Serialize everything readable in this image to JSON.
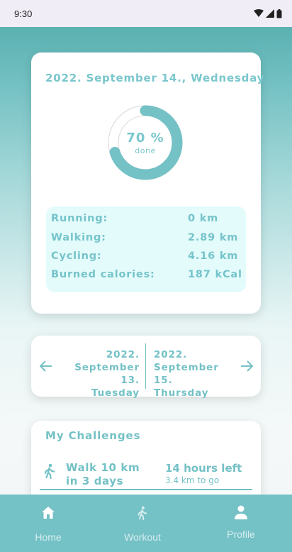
{
  "status_bar": {
    "time": "9:30"
  },
  "summary": {
    "date": "2022. September 14., Wednesday",
    "progress_percent": 70,
    "progress_label": "70 %",
    "progress_caption": "done",
    "stats": [
      {
        "label": "Running:",
        "value": "0 km"
      },
      {
        "label": "Walking:",
        "value": "2.89 km"
      },
      {
        "label": "Cycling:",
        "value": "4.16 km"
      },
      {
        "label": "Burned calories:",
        "value": "187 kCal"
      }
    ]
  },
  "day_nav": {
    "prev_year": "2022.",
    "prev_date": "September 13.",
    "prev_weekday": "Tuesday",
    "next_year": "2022.",
    "next_date": "September 15.",
    "next_weekday": "Thursday"
  },
  "challenges": {
    "title": "My Challenges",
    "items": [
      {
        "name_line1": "Walk 10 km",
        "name_line2": "in 3 days",
        "time_left": "14 hours left",
        "remaining": "3.4 km to go",
        "icon": "walk-icon"
      }
    ]
  },
  "bottom_nav": {
    "items": [
      {
        "label": "Home",
        "icon": "home-icon"
      },
      {
        "label": "Workout",
        "icon": "walk-icon"
      },
      {
        "label": "Profile",
        "icon": "person-icon"
      }
    ]
  },
  "colors": {
    "accent": "#74c1c6",
    "status_bar": "#f1edf6",
    "stats_bg": "#e3fbfb"
  }
}
